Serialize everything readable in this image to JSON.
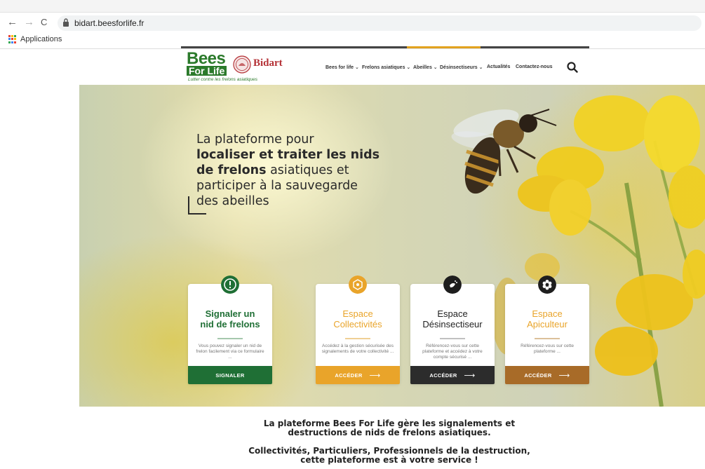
{
  "browser": {
    "back_icon": "←",
    "forward_icon": "→",
    "reload_icon": "C",
    "url": "bidart.beesforlife.fr",
    "bookmarks": {
      "apps_label": "Applications"
    }
  },
  "site": {
    "logo": {
      "line1": "Bees",
      "line2": "For Life",
      "partner": "Bidart",
      "tagline": "Lutter contre les frelons asiatiques"
    },
    "menu": [
      {
        "label": "Bees for life ⌄"
      },
      {
        "label": "Frelons asiatiques ⌄"
      },
      {
        "label": "Abeilles ⌄"
      },
      {
        "label": "Désinsectiseurs ⌄"
      },
      {
        "label": "Actualités"
      },
      {
        "label": "Contactez-nous"
      }
    ],
    "search_icon": "search-icon"
  },
  "hero": {
    "line1": "La plateforme pour",
    "line2": "localiser et traiter les nids",
    "line3a": "de frelons",
    "line3b": " asiatiques et",
    "line4": "participer à la sauvegarde",
    "line5": "des abeilles"
  },
  "cards": [
    {
      "title1": "Signaler un",
      "title2": "nid de frelons",
      "desc": "Vous pouvez signaler un nid de frelon facilement via ce formulaire ...",
      "button": "SIGNALER",
      "arrow": "",
      "color": "#1f6f35",
      "icon": "alert-icon"
    },
    {
      "title1": "Espace",
      "title2": "Collectivités",
      "desc": "Accédez à la gestion sécurisée des signalements de votre collectivité ...",
      "button": "ACCÉDER",
      "arrow": "⟶",
      "color": "#e9a42a",
      "icon": "hexagon-icon"
    },
    {
      "title1": "Espace",
      "title2": "Désinsectiseur",
      "desc": "Référencez-vous sur cette plateforme et accédez à votre compte sécurisé ...",
      "button": "ACCÉDER",
      "arrow": "⟶",
      "color": "#2c2c2c",
      "icon": "spray-icon"
    },
    {
      "title1": "Espace",
      "title2": "Apiculteur",
      "desc": "Référencez-vous sur cette plateforme ...",
      "button": "ACCÉDER",
      "arrow": "⟶",
      "color": "#a86b28",
      "icon": "honeycomb-icon"
    }
  ],
  "intro": {
    "p1_line1": "La plateforme Bees For Life gère les signalements et",
    "p1_line2": "destructions de nids de frelons asiatiques.",
    "p2_line1": "Collectivités, Particuliers, Professionnels de la destruction,",
    "p2_line2": "cette plateforme est à votre service !"
  },
  "colors": {
    "brand_green": "#2b7a2b",
    "accent_orange": "#e2a21e",
    "bidart_red": "#b43035"
  }
}
